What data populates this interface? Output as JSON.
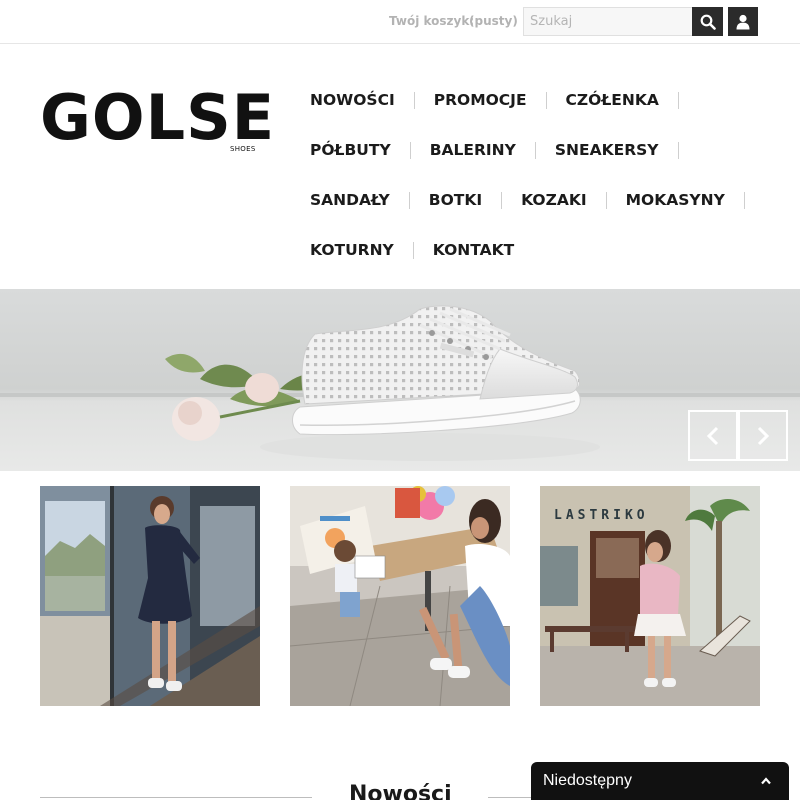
{
  "header": {
    "cart_label": "Twój koszyk:",
    "cart_status": "(pusty)",
    "search_placeholder": "Szukaj",
    "search_icon": "search-icon",
    "user_icon": "user-icon"
  },
  "logo": {
    "text": "GOLSE",
    "subtext": "SHOES"
  },
  "nav": {
    "rows": [
      [
        "NOWOŚCI",
        "PROMOCJE",
        "CZÓŁENKA"
      ],
      [
        "PÓŁBUTY",
        "BALERINY",
        "SNEAKERSY"
      ],
      [
        "SANDAŁY",
        "BOTKI",
        "KOZAKI",
        "MOKASYNY"
      ],
      [
        "KOTURNY",
        "KONTAKT"
      ]
    ]
  },
  "banner": {
    "prev_icon": "chevron-left-icon",
    "next_icon": "chevron-right-icon"
  },
  "tiles": {
    "tile3_sign": "LASTRIKO"
  },
  "section": {
    "title": "Nowości"
  },
  "chat": {
    "status": "Niedostępny",
    "icon": "chevron-up-icon"
  },
  "colors": {
    "dark": "#2b2b2b",
    "muted_text": "#b3b3b3",
    "chat_bg": "#111111"
  }
}
